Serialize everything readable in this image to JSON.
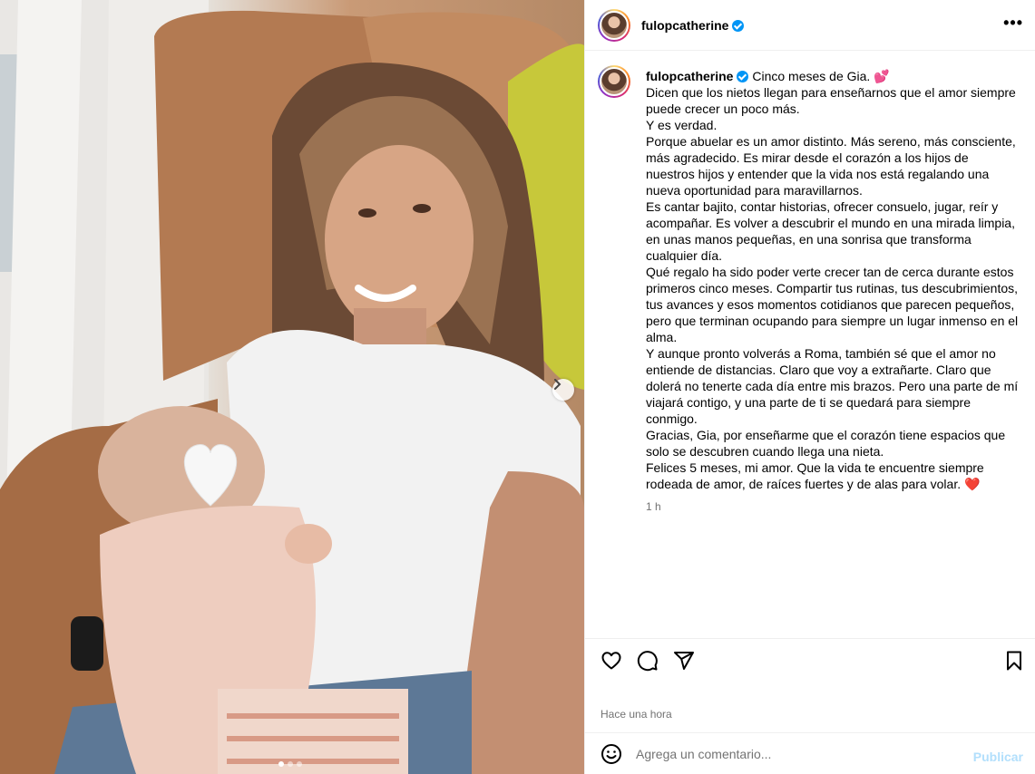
{
  "post": {
    "username": "fulopcatherine",
    "more_label": "•••",
    "caption_first": "Cinco meses de Gia.",
    "caption_first_emoji": "💕",
    "caption_lines": [
      "Dicen que los nietos llegan para enseñarnos que el amor siempre puede crecer un poco más.",
      "Y es verdad.",
      "Porque abuelar es un amor distinto. Más sereno, más consciente, más agradecido. Es mirar desde el corazón a los hijos de nuestros hijos y entender que la vida nos está regalando una nueva oportunidad para maravillarnos.",
      "Es cantar bajito, contar historias, ofrecer consuelo, jugar, reír y acompañar. Es volver a descubrir el mundo en una mirada limpia, en unas manos pequeñas, en una sonrisa que transforma cualquier día.",
      "Qué regalo ha sido poder verte crecer tan de cerca durante estos primeros cinco meses. Compartir tus rutinas, tus descubrimientos, tus avances y esos momentos cotidianos que parecen pequeños, pero que terminan ocupando para siempre un lugar inmenso en el alma.",
      "Y aunque pronto volverás a Roma, también sé que el amor no entiende de distancias. Claro que voy a extrañarte. Claro que dolerá no tenerte cada día entre mis brazos. Pero una parte de mí viajará contigo, y una parte de ti se quedará para siempre conmigo.",
      "Gracias, Gia, por enseñarme que el corazón tiene espacios que solo se descubren cuando llega una nieta.",
      "Felices 5 meses, mi amor. Que la vida te encuentre siempre rodeada de amor, de raíces fuertes y de alas para volar."
    ],
    "caption_last_emoji": "❤️",
    "time_short": "1 h",
    "posted_label": "Hace una hora"
  },
  "comment": {
    "placeholder": "Agrega un comentario...",
    "publish_label": "Publicar"
  },
  "carousel": {
    "slide_count": 3,
    "active_index": 0
  },
  "colors": {
    "verified": "#0095f6",
    "publish_disabled": "#b2dffc",
    "muted_text": "#737373",
    "divider": "#efefef"
  },
  "icons": {
    "like": "heart-icon",
    "comment": "speech-bubble-icon",
    "share": "paper-plane-icon",
    "save": "bookmark-icon",
    "emoji": "smiley-icon",
    "next": "chevron-right-icon"
  }
}
